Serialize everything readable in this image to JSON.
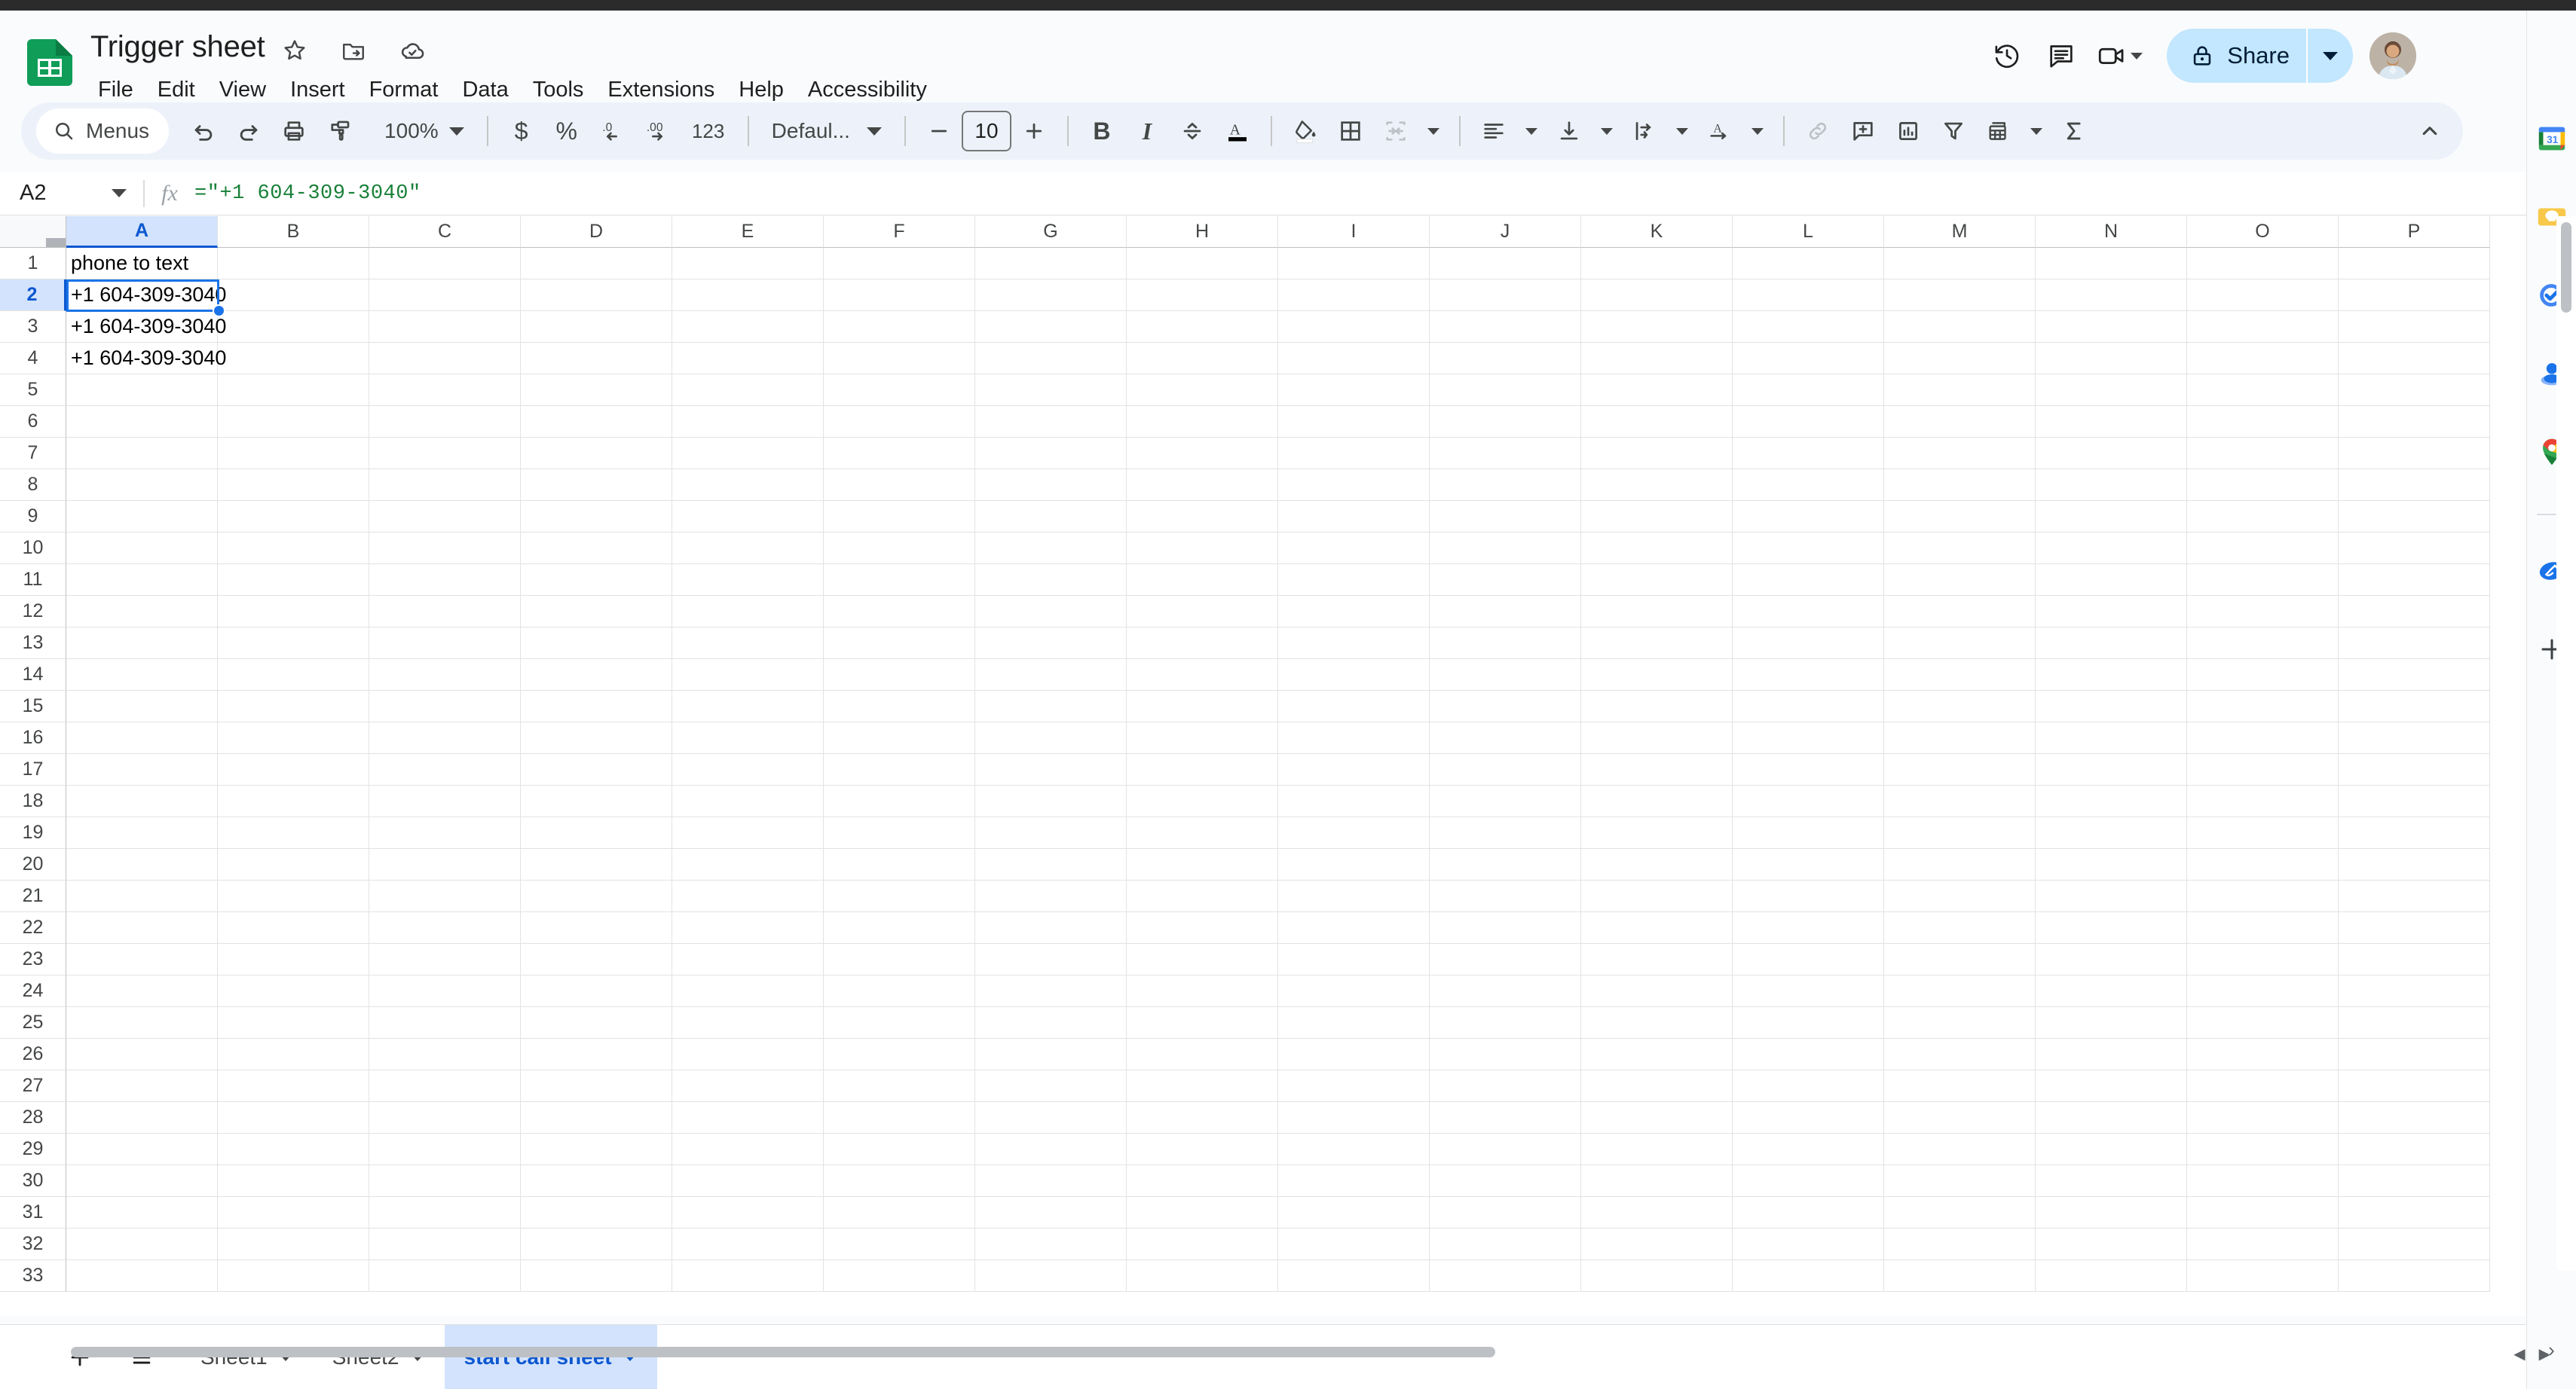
{
  "app": {
    "name": "Google Sheets"
  },
  "header": {
    "doc_title": "Trigger sheet",
    "title_icons": [
      {
        "name": "star-icon",
        "label": "Star"
      },
      {
        "name": "move-to-folder-icon",
        "label": "Move"
      },
      {
        "name": "cloud-saved-icon",
        "label": "Saved to Drive"
      }
    ],
    "menus": [
      "File",
      "Edit",
      "View",
      "Insert",
      "Format",
      "Data",
      "Tools",
      "Extensions",
      "Help",
      "Accessibility"
    ],
    "right_icons": [
      {
        "name": "version-history-icon",
        "label": "Last edit"
      },
      {
        "name": "comment-icon",
        "label": "Comments"
      },
      {
        "name": "meet-icon",
        "label": "Join call"
      }
    ],
    "share_label": "Share",
    "avatar_label": "Account"
  },
  "toolbar": {
    "search_label": "Menus",
    "zoom_label": "100%",
    "font_label": "Defaul...",
    "font_size": "10",
    "items": [
      {
        "name": "undo-icon",
        "label": "Undo"
      },
      {
        "name": "redo-icon",
        "label": "Redo"
      },
      {
        "name": "print-icon",
        "label": "Print"
      },
      {
        "name": "paint-format-icon",
        "label": "Paint format"
      },
      {
        "name": "currency-icon",
        "label": "$"
      },
      {
        "name": "percent-icon",
        "label": "%"
      },
      {
        "name": "decrease-decimal-icon",
        "label": ".0"
      },
      {
        "name": "increase-decimal-icon",
        "label": ".00"
      },
      {
        "name": "more-formats-icon",
        "label": "123"
      },
      {
        "name": "bold-icon",
        "label": "B"
      },
      {
        "name": "italic-icon",
        "label": "I"
      },
      {
        "name": "strikethrough-icon",
        "label": "S"
      },
      {
        "name": "text-color-icon",
        "label": "Text color"
      },
      {
        "name": "fill-color-icon",
        "label": "Fill color"
      },
      {
        "name": "borders-icon",
        "label": "Borders"
      },
      {
        "name": "merge-cells-icon",
        "label": "Merge cells"
      },
      {
        "name": "horizontal-align-icon",
        "label": "Horizontal align"
      },
      {
        "name": "vertical-align-icon",
        "label": "Vertical align"
      },
      {
        "name": "text-wrap-icon",
        "label": "Text wrapping"
      },
      {
        "name": "text-rotation-icon",
        "label": "Text rotation"
      },
      {
        "name": "insert-link-icon",
        "label": "Insert link"
      },
      {
        "name": "insert-comment-icon",
        "label": "Insert comment"
      },
      {
        "name": "insert-chart-icon",
        "label": "Insert chart"
      },
      {
        "name": "filter-icon",
        "label": "Create a filter"
      },
      {
        "name": "functions-icon",
        "label": "Functions"
      },
      {
        "name": "sum-icon",
        "label": "Σ"
      },
      {
        "name": "collapse-toolbar-icon",
        "label": "Hide the menus"
      }
    ]
  },
  "formula_bar": {
    "cell_reference": "A2",
    "formula": "=\"+1 604-309-3040\"",
    "fx_label": "fx"
  },
  "grid": {
    "columns": [
      "A",
      "B",
      "C",
      "D",
      "E",
      "F",
      "G",
      "H",
      "I",
      "J",
      "K",
      "L",
      "M",
      "N",
      "O",
      "P"
    ],
    "selected_column": "A",
    "selected_row": 2,
    "selected_cell": "A2",
    "rows": [
      {
        "n": 1,
        "a": "phone to text"
      },
      {
        "n": 2,
        "a": "+1 604-309-3040"
      },
      {
        "n": 3,
        "a": "+1 604-309-3040"
      },
      {
        "n": 4,
        "a": "+1 604-309-3040"
      },
      {
        "n": 5,
        "a": ""
      },
      {
        "n": 6,
        "a": ""
      },
      {
        "n": 7,
        "a": ""
      },
      {
        "n": 8,
        "a": ""
      },
      {
        "n": 9,
        "a": ""
      },
      {
        "n": 10,
        "a": ""
      },
      {
        "n": 11,
        "a": ""
      },
      {
        "n": 12,
        "a": ""
      },
      {
        "n": 13,
        "a": ""
      },
      {
        "n": 14,
        "a": ""
      },
      {
        "n": 15,
        "a": ""
      },
      {
        "n": 16,
        "a": ""
      },
      {
        "n": 17,
        "a": ""
      },
      {
        "n": 18,
        "a": ""
      },
      {
        "n": 19,
        "a": ""
      },
      {
        "n": 20,
        "a": ""
      },
      {
        "n": 21,
        "a": ""
      },
      {
        "n": 22,
        "a": ""
      },
      {
        "n": 23,
        "a": ""
      },
      {
        "n": 24,
        "a": ""
      },
      {
        "n": 25,
        "a": ""
      },
      {
        "n": 26,
        "a": ""
      },
      {
        "n": 27,
        "a": ""
      },
      {
        "n": 28,
        "a": ""
      },
      {
        "n": 29,
        "a": ""
      },
      {
        "n": 30,
        "a": ""
      },
      {
        "n": 31,
        "a": ""
      },
      {
        "n": 32,
        "a": ""
      },
      {
        "n": 33,
        "a": ""
      }
    ]
  },
  "sheet_bar": {
    "add_label": "+",
    "all_sheets_label": "All sheets",
    "tabs": [
      {
        "label": "Sheet1",
        "active": false
      },
      {
        "label": "Sheet2",
        "active": false
      },
      {
        "label": "start call sheet",
        "active": true
      }
    ]
  },
  "sidebar": {
    "apps": [
      {
        "name": "google-calendar-icon",
        "label": "Calendar",
        "badge": "31"
      },
      {
        "name": "google-keep-icon",
        "label": "Keep"
      },
      {
        "name": "google-tasks-icon",
        "label": "Tasks"
      },
      {
        "name": "google-contacts-icon",
        "label": "Contacts"
      },
      {
        "name": "google-maps-icon",
        "label": "Maps"
      },
      {
        "name": "signature-addon-icon",
        "label": "Signature add-on"
      }
    ],
    "add_label": "+",
    "expand_label": "›"
  },
  "colors": {
    "sheets_green": "#0F9D58",
    "accent_blue": "#1a73e8",
    "selected_tab_blue": "#0b57d0",
    "share_bg": "#C2E7FF",
    "toolbar_bg": "#EDF2FA",
    "formula_green": "#188038",
    "header_bg": "#F9FBFD"
  }
}
